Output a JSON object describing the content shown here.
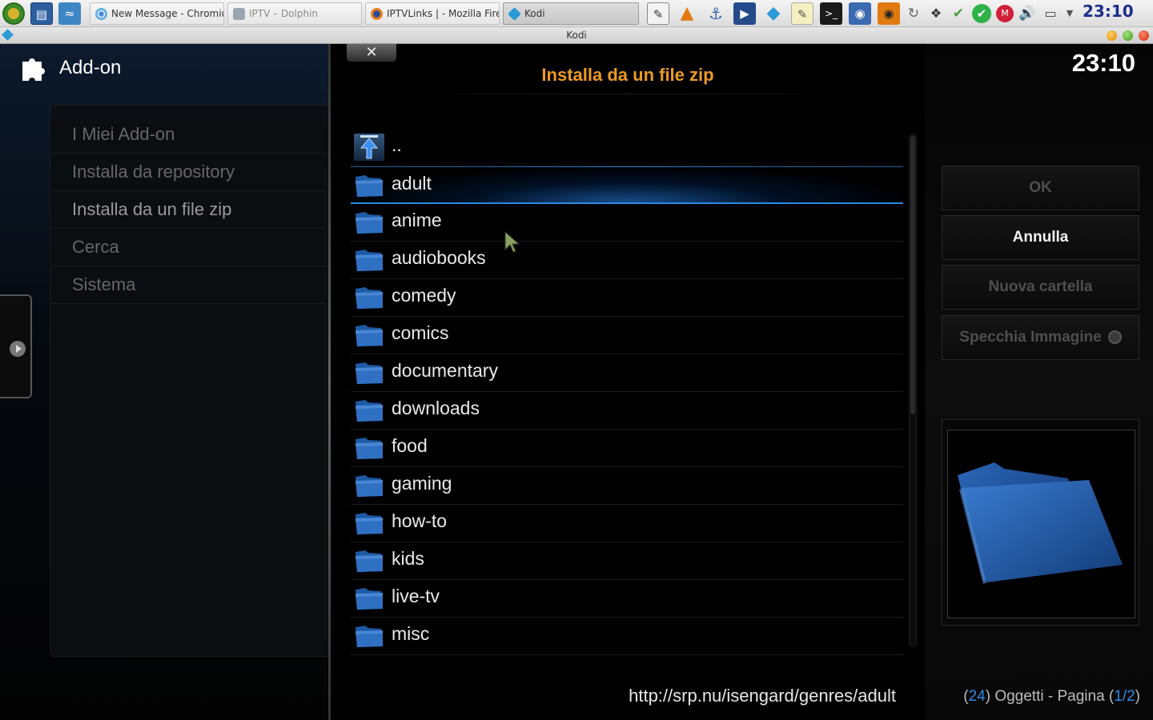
{
  "taskbar": {
    "tasks": [
      {
        "label": "New Message - Chromium",
        "icon": "chromium-icon"
      },
      {
        "label": "IPTV – Dolphin",
        "icon": "dolphin-icon"
      },
      {
        "label": "IPTVLinks | - Mozilla Firefox",
        "icon": "firefox-icon"
      },
      {
        "label": "Kodi",
        "icon": "kodi-icon"
      }
    ],
    "clock": "23:10"
  },
  "window": {
    "title": "Kodi"
  },
  "kodi": {
    "section_title": "Add-on",
    "clock": "23:10",
    "menu": [
      {
        "label": "I Miei Add-on"
      },
      {
        "label": "Installa da repository"
      },
      {
        "label": "Installa da un file zip"
      },
      {
        "label": "Cerca"
      },
      {
        "label": "Sistema"
      }
    ],
    "dialog": {
      "close_symbol": "✕",
      "title": "Installa da un file zip",
      "items": [
        "..",
        "adult",
        "anime",
        "audiobooks",
        "comedy",
        "comics",
        "documentary",
        "downloads",
        "food",
        "gaming",
        "how-to",
        "kids",
        "live-tv",
        "misc"
      ],
      "selected": "adult",
      "path": "http://srp.nu/isengard/genres/adult"
    },
    "buttons": {
      "ok": "OK",
      "cancel": "Annulla",
      "new_folder": "Nuova cartella",
      "mirror_image": "Specchia Immagine"
    },
    "footer": {
      "count": "24",
      "items_word": "Oggetti - Pagina",
      "page": "1/2"
    }
  },
  "colors": {
    "accent_orange": "#eb9a26",
    "accent_blue": "#2d8ae6",
    "folder_blue": "#1d5aa5"
  }
}
